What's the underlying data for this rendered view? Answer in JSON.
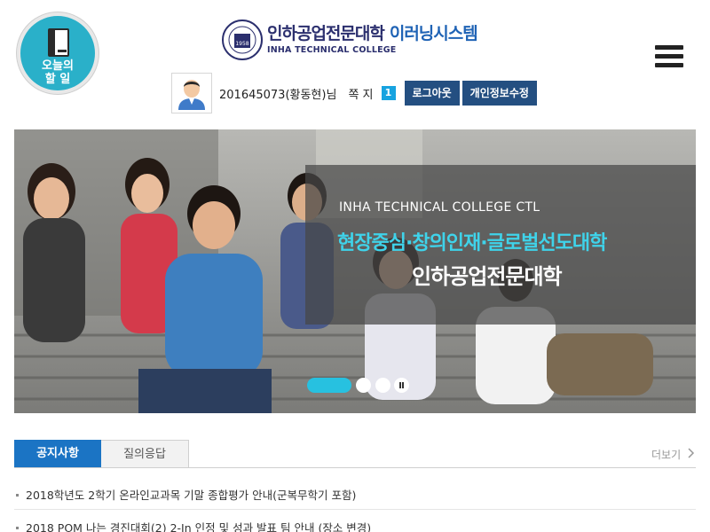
{
  "today_tasks": {
    "label_line1": "오늘의",
    "label_line2": "할 일",
    "icon": "book-icon"
  },
  "header": {
    "logo_kor": "인하공업전문대학",
    "logo_accent": "이러닝시스템",
    "logo_eng": "INHA TECHNICAL COLLEGE",
    "seal_year": "1958",
    "menu_icon": "hamburger-icon"
  },
  "user": {
    "name": "201645073(황동현)님",
    "messages_label": "쪽 지",
    "messages_count": "1",
    "logout_label": "로그아웃",
    "profile_edit_label": "개인정보수정"
  },
  "banner": {
    "eng_title": "INHA TECHNICAL COLLEGE CTL",
    "slogan": "현장중심·창의인재·글로벌선도대학",
    "college": "인하공업전문대학"
  },
  "board": {
    "tabs": [
      {
        "label": "공지사항",
        "active": true
      },
      {
        "label": "질의응답",
        "active": false
      }
    ],
    "more_label": "더보기",
    "notices": [
      "2018학년도 2학기 온라인교과목 기말 종합평가 안내(군복무학기 포함)",
      "2018 POM 나는 경진대회(2) 2-In 인정 및 성과 발표 팀 안내 (장소 변경)"
    ]
  },
  "colors": {
    "accent": "#1b74c4",
    "button": "#244f81",
    "cyan": "#2ab0c9",
    "slogan": "#3fd3ea"
  }
}
